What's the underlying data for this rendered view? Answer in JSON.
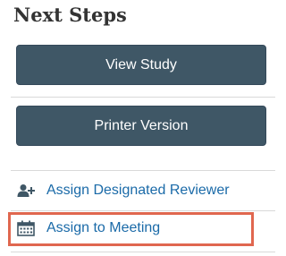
{
  "panel": {
    "title": "Next Steps",
    "buttons": {
      "view_study": "View Study",
      "printer_version": "Printer Version"
    },
    "actions": [
      {
        "label": "Assign Designated Reviewer",
        "icon": "add-user-icon"
      },
      {
        "label": "Assign to Meeting",
        "icon": "calendar-icon"
      }
    ],
    "highlighted_action": "Assign to Meeting"
  },
  "colors": {
    "button_bg": "#3f5766",
    "link": "#1a6aa8",
    "highlight": "#e0674f"
  }
}
